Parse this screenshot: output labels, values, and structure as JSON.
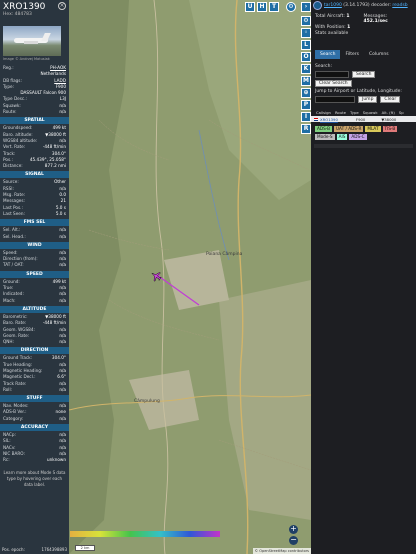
{
  "info": {
    "callsign": "XRO1390",
    "hex_label": "Hex: 484783",
    "photo_credit": "Image © Andrzej Matusiak",
    "rows_top": [
      [
        "Reg.:",
        "PH-AOK"
      ],
      [
        "",
        "Netherlands"
      ],
      [
        "DB flags:",
        "LADD"
      ],
      [
        "Type:",
        "F900"
      ],
      [
        "",
        "DASSAULT Falcon 900"
      ],
      [
        "Type Desc.:",
        "L3J"
      ],
      [
        "Squawk:",
        "n/a"
      ],
      [
        "Route:",
        "n/a"
      ]
    ],
    "spatial_title": "SPATIAL",
    "spatial": [
      [
        "Groundspeed:",
        "499 kt"
      ],
      [
        "Baro. altitude:",
        "▼38000 ft"
      ],
      [
        "WGS84 altitude:",
        "n/a"
      ],
      [
        "Vert. Rate:",
        "-448 ft/min"
      ],
      [
        "Track:",
        "304.0°"
      ],
      [
        "Pos.:",
        "45.439°, 25.058°"
      ],
      [
        "Distance:",
        "877.2 nmi"
      ]
    ],
    "signal_title": "SIGNAL",
    "signal": [
      [
        "Source:",
        "Other"
      ],
      [
        "RSSI:",
        "n/a"
      ],
      [
        "Msg. Rate:",
        "0.0"
      ],
      [
        "Messages:",
        "21"
      ],
      [
        "Last Pos.:",
        "5.0 s"
      ],
      [
        "Last Seen:",
        "5.0 s"
      ]
    ],
    "fms_title": "FMS SEL",
    "fms": [
      [
        "Sel. Alt.:",
        "n/a"
      ],
      [
        "Sel. Head.:",
        "n/a"
      ]
    ],
    "wind_title": "WIND",
    "wind": [
      [
        "Speed:",
        "n/a"
      ],
      [
        "Direction (from):",
        "n/a"
      ],
      [
        "TAT / OAT:",
        "n/a"
      ]
    ],
    "speed_title": "SPEED",
    "speed": [
      [
        "Ground:",
        "499 kt"
      ],
      [
        "True:",
        "n/a"
      ],
      [
        "Indicated:",
        "n/a"
      ],
      [
        "Mach:",
        "n/a"
      ]
    ],
    "altitude_title": "ALTITUDE",
    "altitude": [
      [
        "Barometric:",
        "▼38000 ft"
      ],
      [
        "Baro. Rate:",
        "-448 ft/min"
      ],
      [
        "Geom. WGS84:",
        "n/a"
      ],
      [
        "Geom. Rate:",
        "n/a"
      ],
      [
        "QNH:",
        "n/a"
      ]
    ],
    "direction_title": "DIRECTION",
    "direction": [
      [
        "Ground Track:",
        "304.0°"
      ],
      [
        "True Heading:",
        "n/a"
      ],
      [
        "Magnetic Heading:",
        "n/a"
      ],
      [
        "Magnetic Decl.:",
        "6.6°"
      ],
      [
        "Track Rate:",
        "n/a"
      ],
      [
        "Roll:",
        "n/a"
      ]
    ],
    "stuff_title": "STUFF",
    "stuff": [
      [
        "Nav. Modes:",
        "n/a"
      ],
      [
        "ADS-B Ver.:",
        "none"
      ],
      [
        "Category:",
        "n/a"
      ]
    ],
    "accuracy_title": "ACCURACY",
    "accuracy": [
      [
        "NACp:",
        "n/a"
      ],
      [
        "SIL:",
        "n/a"
      ],
      [
        "NACv:",
        "n/a"
      ],
      [
        "NIC BARO:",
        "n/a"
      ],
      [
        "Rc:",
        "unknown"
      ]
    ],
    "note": "Learn more about Mode S data type by hovering over each data label.",
    "epoch_label": "Pos. epoch:",
    "epoch_value": "1764398893"
  },
  "map": {
    "top_buttons": [
      "U",
      "H",
      "T"
    ],
    "side_buttons": [
      "L",
      "O",
      "K",
      "M",
      "P",
      "I",
      "R"
    ],
    "towns": [
      "Poiana Câmpina",
      "Câmpulung"
    ],
    "zoom_in": "+",
    "zoom_out": "−",
    "scale": "2 km",
    "attribution": "© OpenStreetMap contributors",
    "legend": [
      "",
      "",
      "",
      "",
      "",
      "",
      "",
      "",
      "",
      "",
      "",
      "",
      "",
      "",
      "",
      "",
      "",
      "",
      ""
    ]
  },
  "panel": {
    "app_link": "tar1090",
    "version": "(3.14.1793) decoder:",
    "decoder_link": "readsb",
    "total_label": "Total Aircraft:",
    "total_value": "1",
    "messages_label": "Messages:",
    "messages_value": "452.1/sec",
    "withpos_label": "With Position:",
    "withpos_value": "1",
    "stats_label": "Stats available",
    "tabs": [
      "Search",
      "Filters",
      "Columns"
    ],
    "search_label": "Search:",
    "search_btn": "Search",
    "clear_search": "Clear Search",
    "jump_label": "Jump to Airport or Latitude, Longitude:",
    "jump_btn": "Jump",
    "clear_btn": "Clear",
    "cols": [
      "Callsign",
      "Route",
      "Type",
      "Squawk",
      "Alt. (ft)",
      "Sp"
    ],
    "row": [
      "XRO1390",
      "",
      "F900",
      "",
      "▼38000",
      ""
    ],
    "chips": [
      [
        "ADS-B",
        "#7fcf7f"
      ],
      [
        "UAT / ADS-R",
        "#caa36a"
      ],
      [
        "MLAT",
        "#d8c85a"
      ],
      [
        "TIS-B",
        "#e07a7a"
      ],
      [
        "Mode-S",
        "#bdbdbd"
      ],
      [
        "AIS",
        "#9fd"
      ],
      [
        "ADS-C",
        "#c6a4e8"
      ]
    ]
  },
  "colors": {
    "accent": "#1f6ea5",
    "track": "#c13bd6",
    "aircraft": "#c845d8"
  }
}
